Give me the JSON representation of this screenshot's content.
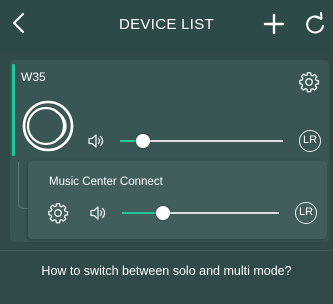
{
  "header": {
    "title": "DEVICE LIST",
    "back_icon": "chevron-left-icon",
    "add_icon": "plus-icon",
    "refresh_icon": "refresh-icon"
  },
  "main_device": {
    "name": "W35",
    "volume_percent": 14,
    "channel_badge": "LR",
    "settings_icon": "gear-icon",
    "status_icon": "disc-icon",
    "volume_icon": "speaker-icon"
  },
  "grouped_device": {
    "name": "Music Center Connect",
    "volume_percent": 26,
    "channel_badge": "LR",
    "settings_icon": "gear-icon",
    "volume_icon": "speaker-icon"
  },
  "help": {
    "text": "How to switch between solo and multi mode?"
  },
  "colors": {
    "background": "#2f4a48",
    "card": "#395654",
    "sub_card": "#415e5c",
    "accent": "#1fc79a"
  }
}
